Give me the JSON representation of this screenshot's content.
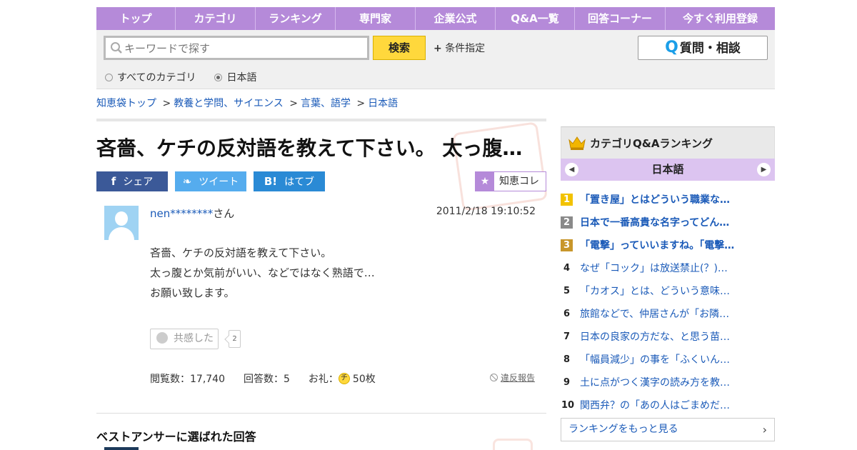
{
  "nav": {
    "items": [
      {
        "label": "トップ"
      },
      {
        "label": "カテゴリ"
      },
      {
        "label": "ランキング"
      },
      {
        "label": "専門家"
      },
      {
        "label": "企業公式"
      },
      {
        "label": "Q&A一覧"
      },
      {
        "label": "回答コーナー"
      },
      {
        "label": "今すぐ利用登録"
      }
    ]
  },
  "search": {
    "placeholder": "キーワードで探す",
    "button_label": "検索",
    "condition_label": "条件指定",
    "ask_label": "質問・相談",
    "ask_q": "Q",
    "scope_options": [
      {
        "label": "すべてのカテゴリ",
        "selected": false
      },
      {
        "label": "日本語",
        "selected": true
      }
    ]
  },
  "breadcrumb": [
    "知恵袋トップ",
    "教養と学問、サイエンス",
    "言葉、語学",
    "日本語"
  ],
  "question": {
    "title": "吝嗇、ケチの反対語を教えて下さい。 太っ腹…",
    "share": {
      "facebook": "シェア",
      "twitter": "ツイート",
      "hatena": "はてブ",
      "facebook_icon": "f",
      "twitter_icon": "❧",
      "hatena_icon": "B!"
    },
    "chiekore_label": "知恵コレ",
    "user": "nen********",
    "user_suffix": "さん",
    "datetime": "2011/2/18  19:10:52",
    "body_lines": [
      "吝嗇、ケチの反対語を教えて下さい。",
      "太っ腹とか気前がいい、などではなく熟語で…",
      "お願い致します。"
    ],
    "empathy_label": "共感した",
    "empathy_count": "2",
    "views_label": "閲覧数：17,740",
    "answers_label": "回答数：5",
    "reward_prefix": "お礼：",
    "reward_icon": "チ",
    "reward_value": "50枚",
    "report_label": "違反報告"
  },
  "best_answer_heading": "ベストアンサーに選ばれた回答",
  "ranking": {
    "title": "カテゴリQ&Aランキング",
    "category": "日本語",
    "items": [
      {
        "rank": "1",
        "text": "「置き屋」とはどういう職業な…"
      },
      {
        "rank": "2",
        "text": "日本で一番高貴な名字ってどん…"
      },
      {
        "rank": "3",
        "text": "「電撃」っていいますね。「電撃…"
      },
      {
        "rank": "4",
        "text": "なぜ「コック」は放送禁止(？)…"
      },
      {
        "rank": "5",
        "text": "「カオス」とは、どういう意味…"
      },
      {
        "rank": "6",
        "text": "旅館などで、仲居さんが「お隣…"
      },
      {
        "rank": "7",
        "text": "日本の良家の方だな、と思う苗…"
      },
      {
        "rank": "8",
        "text": "「幅員減少」の事を「ふくいん…"
      },
      {
        "rank": "9",
        "text": "土に点がつく漢字の読み方を教…"
      },
      {
        "rank": "10",
        "text": "関西弁？の「あの人はごまめだ…"
      }
    ],
    "more_label": "ランキングをもっと見る"
  },
  "colors": {
    "accent_purple": "#b58ad9",
    "search_yellow": "#ffd83c",
    "link_blue": "#1a5ab8",
    "facebook": "#3b5998",
    "twitter": "#55acee",
    "hatena": "#2a8ad5"
  }
}
